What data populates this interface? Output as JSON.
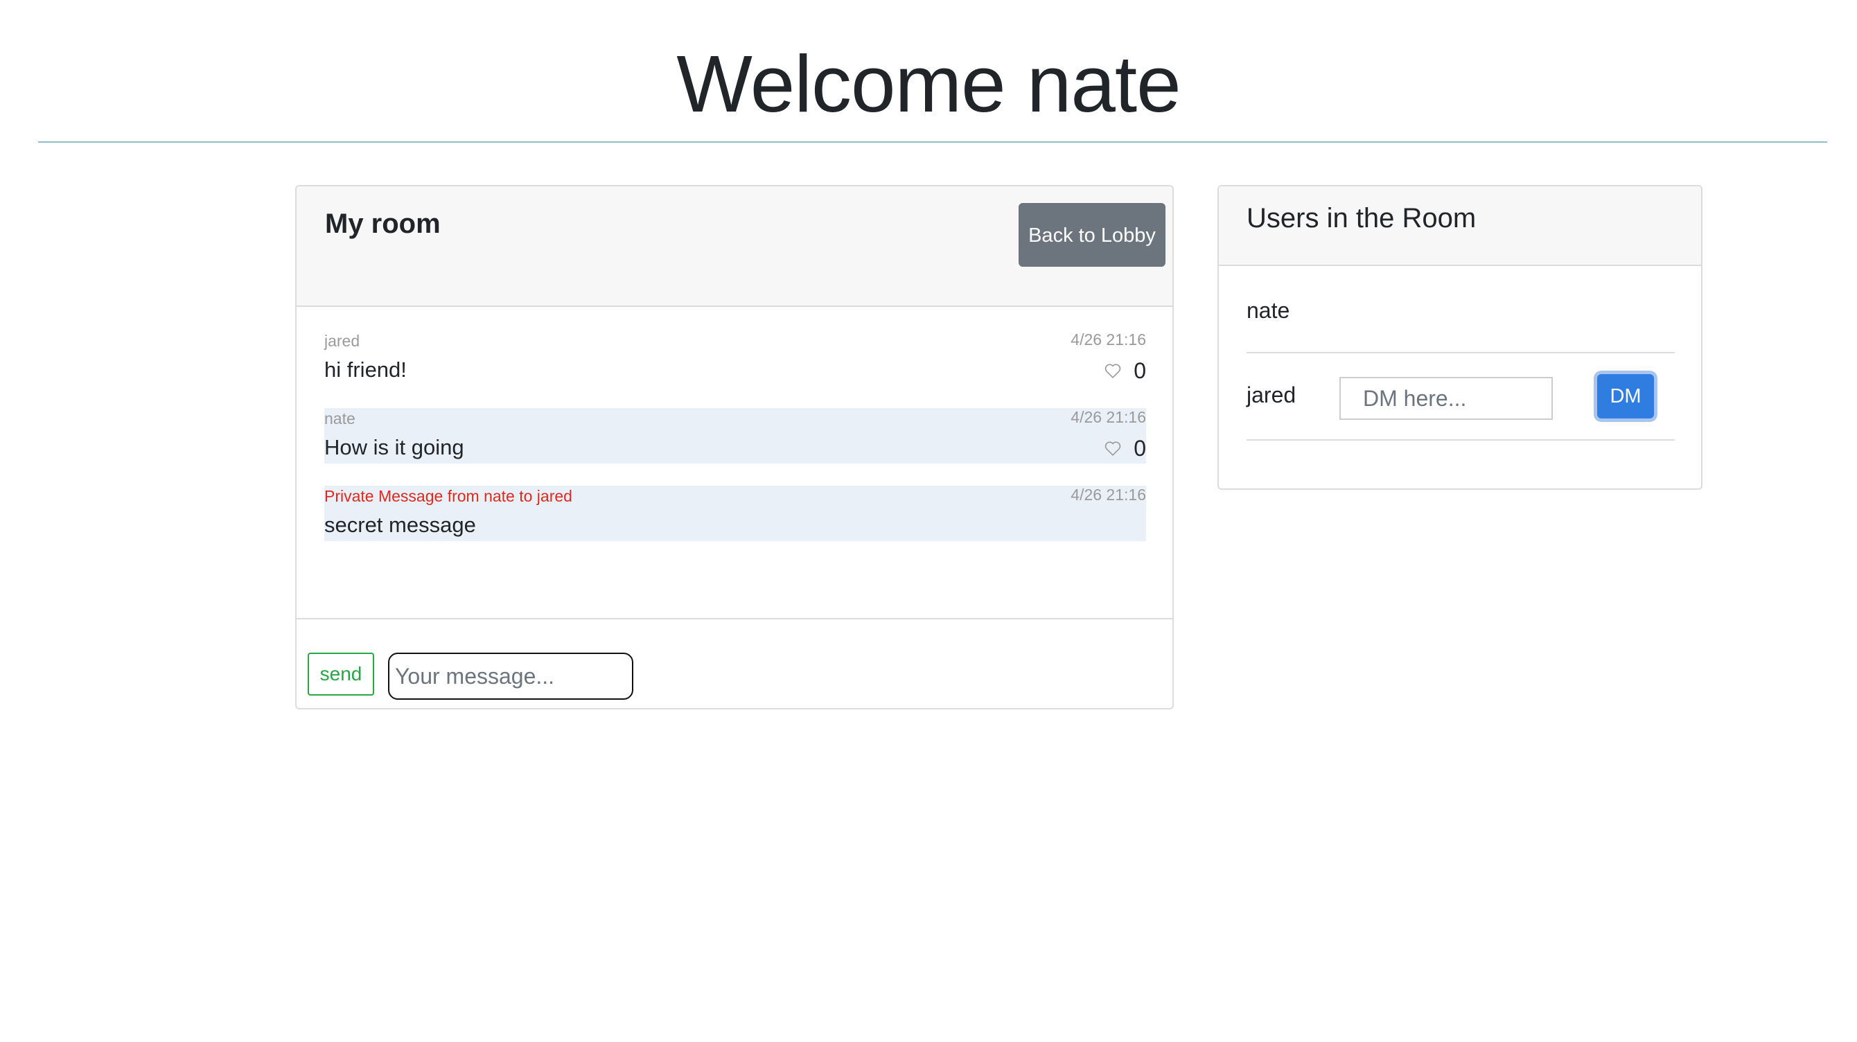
{
  "page": {
    "title": "Welcome nate"
  },
  "room": {
    "title": "My room",
    "back_button_label": "Back to Lobby",
    "messages": [
      {
        "sender": "jared",
        "time": "4/26 21:16",
        "text": "hi friend!",
        "likes": "0"
      },
      {
        "sender": "nate",
        "time": "4/26 21:16",
        "text": "How is it going",
        "likes": "0"
      },
      {
        "sender": "Private Message from nate to jared",
        "time": "4/26 21:16",
        "text": "secret message"
      }
    ],
    "send_label": "send",
    "input_placeholder": "Your message..."
  },
  "users": {
    "title": "Users in the Room",
    "list": [
      {
        "name": "nate"
      },
      {
        "name": "jared",
        "dm_placeholder": "DM here...",
        "dm_label": "DM"
      }
    ]
  },
  "colors": {
    "accent_blue": "#2f7de1",
    "secondary_gray": "#6c757d",
    "success_green": "#28a745",
    "private_red": "#dd2a1f",
    "own_message_bg": "#e9f0f8"
  },
  "icons": {
    "like": "heart-outline-icon"
  }
}
